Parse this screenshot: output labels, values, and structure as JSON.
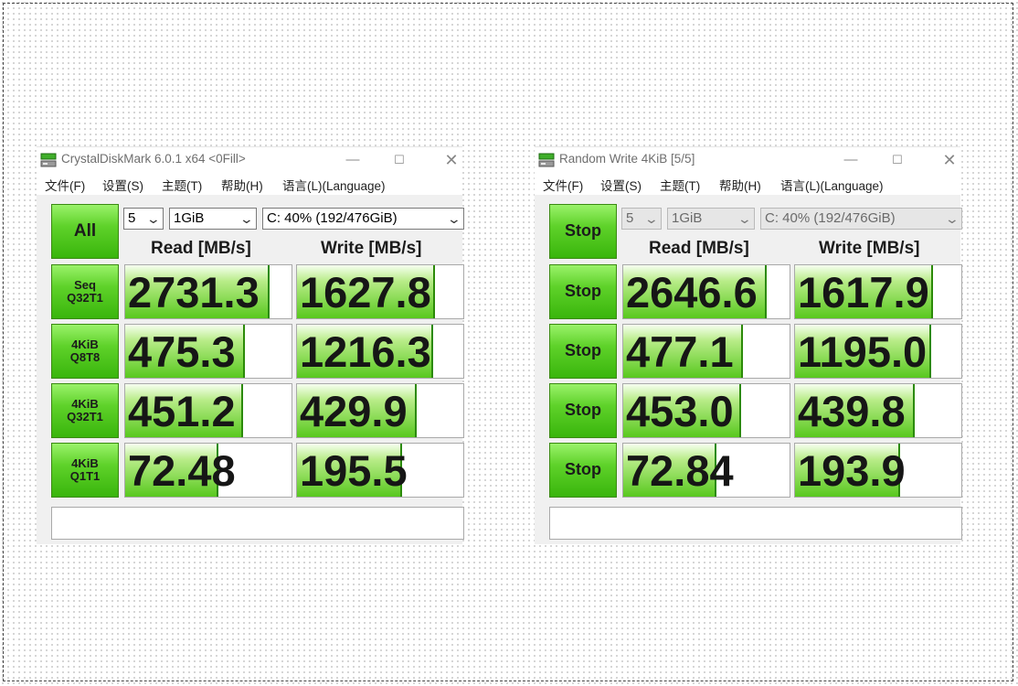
{
  "windows": [
    {
      "title": "CrystalDiskMark 6.0.1 x64 <0Fill>",
      "controls": {
        "minimize": "—",
        "maximize": "☐",
        "close": "✕"
      },
      "menu": [
        "文件(F)",
        "设置(S)",
        "主题(T)",
        "帮助(H)",
        "语言(L)(Language)"
      ],
      "main_button": "All",
      "selects": {
        "count": "5",
        "size": "1GiB",
        "drive": "C: 40% (192/476GiB)"
      },
      "selects_disabled": false,
      "headers": {
        "read": "Read [MB/s]",
        "write": "Write [MB/s]"
      },
      "rows": [
        {
          "label_line1": "Seq",
          "label_line2": "Q32T1",
          "read": "2731.3",
          "write": "1627.8",
          "read_fill": 0.87,
          "write_fill": 0.83
        },
        {
          "label_line1": "4KiB",
          "label_line2": "Q8T8",
          "read": "475.3",
          "write": "1216.3",
          "read_fill": 0.72,
          "write_fill": 0.82
        },
        {
          "label_line1": "4KiB",
          "label_line2": "Q32T1",
          "read": "451.2",
          "write": "429.9",
          "read_fill": 0.71,
          "write_fill": 0.72
        },
        {
          "label_line1": "4KiB",
          "label_line2": "Q1T1",
          "read": "72.48",
          "write": "195.5",
          "read_fill": 0.56,
          "write_fill": 0.63
        }
      ],
      "comment": ""
    },
    {
      "title": "Random Write 4KiB [5/5]",
      "controls": {
        "minimize": "—",
        "maximize": "☐",
        "close": "✕"
      },
      "menu": [
        "文件(F)",
        "设置(S)",
        "主题(T)",
        "帮助(H)",
        "语言(L)(Language)"
      ],
      "main_button": "Stop",
      "selects": {
        "count": "5",
        "size": "1GiB",
        "drive": "C: 40% (192/476GiB)"
      },
      "selects_disabled": true,
      "headers": {
        "read": "Read [MB/s]",
        "write": "Write [MB/s]"
      },
      "rows": [
        {
          "label": "Stop",
          "read": "2646.6",
          "write": "1617.9",
          "read_fill": 0.86,
          "write_fill": 0.83
        },
        {
          "label": "Stop",
          "read": "477.1",
          "write": "1195.0",
          "read_fill": 0.72,
          "write_fill": 0.82
        },
        {
          "label": "Stop",
          "read": "453.0",
          "write": "439.8",
          "read_fill": 0.71,
          "write_fill": 0.72
        },
        {
          "label": "Stop",
          "read": "72.84",
          "write": "193.9",
          "read_fill": 0.56,
          "write_fill": 0.63
        }
      ],
      "comment": ""
    }
  ]
}
